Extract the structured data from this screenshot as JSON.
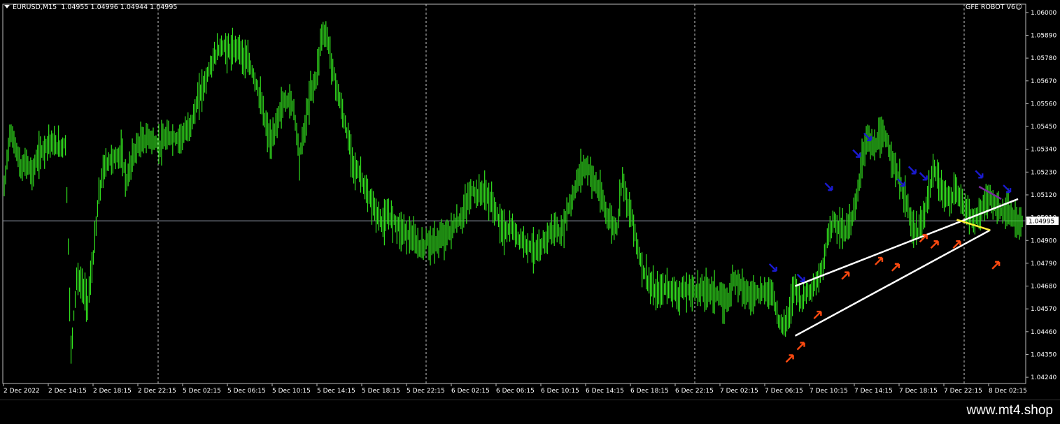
{
  "header": {
    "symbol": "EURUSD,M15",
    "ohlc": "1.04955 1.04996 1.04944 1.04995"
  },
  "indicator_label": "GFE ROBOT V6",
  "footer": {
    "brand": "www.mt4.shop"
  },
  "colors": {
    "background": "#000000",
    "candle": "#32e21e",
    "grid": "#c8c8c8",
    "text": "#ffffff",
    "current_price_line": "#8a8fa0",
    "trendline": "#ffffff",
    "down_arrow": "#1a1ad0",
    "up_arrow": "#ff4a10",
    "yellow_line": "#ffee33",
    "purple_line": "#7a2aa0"
  },
  "chart_data": {
    "type": "candlestick",
    "title": "EURUSD,M15",
    "xlabel": "",
    "ylabel": "",
    "grid": "vertical dashed",
    "current_price": 1.04995,
    "ylim": [
      1.0421,
      1.0604
    ],
    "y_ticks": [
      "1.06000",
      "1.05890",
      "1.05780",
      "1.05670",
      "1.05560",
      "1.05450",
      "1.05340",
      "1.05230",
      "1.05120",
      "1.05010",
      "1.04900",
      "1.04790",
      "1.04680",
      "1.04570",
      "1.04460",
      "1.04350",
      "1.04240"
    ],
    "x_ticks": [
      "2 Dec 2022",
      "2 Dec 14:15",
      "2 Dec 18:15",
      "2 Dec 22:15",
      "5 Dec 02:15",
      "5 Dec 06:15",
      "5 Dec 10:15",
      "5 Dec 14:15",
      "5 Dec 18:15",
      "5 Dec 22:15",
      "6 Dec 02:15",
      "6 Dec 06:15",
      "6 Dec 10:15",
      "6 Dec 14:15",
      "6 Dec 18:15",
      "6 Dec 22:15",
      "7 Dec 02:15",
      "7 Dec 06:15",
      "7 Dec 10:15",
      "7 Dec 14:15",
      "7 Dec 18:15",
      "7 Dec 22:15",
      "8 Dec 02:15"
    ],
    "close_path": [
      [
        0,
        1.0515
      ],
      [
        1,
        1.0542
      ],
      [
        2,
        1.0536
      ],
      [
        3,
        1.0524
      ],
      [
        4,
        1.0528
      ],
      [
        5,
        1.0522
      ],
      [
        6,
        1.053
      ],
      [
        7,
        1.0534
      ],
      [
        8,
        1.0538
      ],
      [
        9,
        1.0536
      ],
      [
        10,
        1.0535
      ],
      [
        11,
        1.0537
      ],
      [
        12,
        1.0436
      ],
      [
        13,
        1.0472
      ],
      [
        14,
        1.0468
      ],
      [
        15,
        1.046
      ],
      [
        16,
        1.0482
      ],
      [
        17,
        1.0512
      ],
      [
        18,
        1.0526
      ],
      [
        19,
        1.0529
      ],
      [
        20,
        1.053
      ],
      [
        21,
        1.0532
      ],
      [
        22,
        1.0518
      ],
      [
        23,
        1.053
      ],
      [
        24,
        1.0536
      ],
      [
        25,
        1.0538
      ],
      [
        26,
        1.054
      ],
      [
        27,
        1.0537
      ],
      [
        28,
        1.0536
      ],
      [
        29,
        1.0539
      ],
      [
        30,
        1.054
      ],
      [
        31,
        1.0539
      ],
      [
        32,
        1.0541
      ],
      [
        33,
        1.0543
      ],
      [
        34,
        1.055
      ],
      [
        35,
        1.056
      ],
      [
        36,
        1.0566
      ],
      [
        37,
        1.0574
      ],
      [
        38,
        1.058
      ],
      [
        39,
        1.0584
      ],
      [
        40,
        1.0582
      ],
      [
        41,
        1.0581
      ],
      [
        42,
        1.0584
      ],
      [
        43,
        1.0578
      ],
      [
        44,
        1.0575
      ],
      [
        45,
        1.0568
      ],
      [
        46,
        1.0558
      ],
      [
        47,
        1.0545
      ],
      [
        48,
        1.0536
      ],
      [
        49,
        1.0548
      ],
      [
        50,
        1.0556
      ],
      [
        51,
        1.0558
      ],
      [
        52,
        1.0554
      ],
      [
        53,
        1.053
      ],
      [
        54,
        1.0545
      ],
      [
        55,
        1.0562
      ],
      [
        56,
        1.0568
      ],
      [
        57,
        1.059
      ],
      [
        58,
        1.0588
      ],
      [
        59,
        1.0572
      ],
      [
        60,
        1.056
      ],
      [
        61,
        1.0548
      ],
      [
        62,
        1.0536
      ],
      [
        63,
        1.0524
      ],
      [
        64,
        1.0522
      ],
      [
        65,
        1.0512
      ],
      [
        66,
        1.0508
      ],
      [
        67,
        1.0502
      ],
      [
        68,
        1.0498
      ],
      [
        69,
        1.0502
      ],
      [
        70,
        1.05
      ],
      [
        71,
        1.0496
      ],
      [
        72,
        1.0494
      ],
      [
        73,
        1.0492
      ],
      [
        74,
        1.0488
      ],
      [
        75,
        1.0486
      ],
      [
        76,
        1.049
      ],
      [
        77,
        1.0488
      ],
      [
        78,
        1.049
      ],
      [
        79,
        1.0492
      ],
      [
        80,
        1.0494
      ],
      [
        81,
        1.0498
      ],
      [
        82,
        1.05
      ],
      [
        83,
        1.0508
      ],
      [
        84,
        1.0514
      ],
      [
        85,
        1.0512
      ],
      [
        86,
        1.0514
      ],
      [
        87,
        1.051
      ],
      [
        88,
        1.0506
      ],
      [
        89,
        1.0498
      ],
      [
        90,
        1.0494
      ],
      [
        91,
        1.0496
      ],
      [
        92,
        1.0492
      ],
      [
        93,
        1.049
      ],
      [
        94,
        1.0488
      ],
      [
        95,
        1.0486
      ],
      [
        96,
        1.0484
      ],
      [
        97,
        1.049
      ],
      [
        98,
        1.0494
      ],
      [
        99,
        1.0496
      ],
      [
        100,
        1.0492
      ],
      [
        101,
        1.0504
      ],
      [
        102,
        1.051
      ],
      [
        103,
        1.052
      ],
      [
        104,
        1.0526
      ],
      [
        105,
        1.0524
      ],
      [
        106,
        1.0518
      ],
      [
        107,
        1.0512
      ],
      [
        108,
        1.0504
      ],
      [
        109,
        1.0498
      ],
      [
        110,
        1.0496
      ],
      [
        111,
        1.0522
      ],
      [
        112,
        1.0506
      ],
      [
        113,
        1.0498
      ],
      [
        114,
        1.0482
      ],
      [
        115,
        1.0474
      ],
      [
        116,
        1.0468
      ],
      [
        117,
        1.0464
      ],
      [
        118,
        1.0466
      ],
      [
        119,
        1.0468
      ],
      [
        120,
        1.0466
      ],
      [
        121,
        1.0464
      ],
      [
        122,
        1.0466
      ],
      [
        123,
        1.0466
      ],
      [
        124,
        1.0466
      ],
      [
        125,
        1.0466
      ],
      [
        126,
        1.0466
      ],
      [
        127,
        1.0466
      ],
      [
        128,
        1.0464
      ],
      [
        129,
        1.046
      ],
      [
        130,
        1.0462
      ],
      [
        131,
        1.0472
      ],
      [
        132,
        1.047
      ],
      [
        133,
        1.0466
      ],
      [
        134,
        1.0462
      ],
      [
        135,
        1.0466
      ],
      [
        136,
        1.0464
      ],
      [
        137,
        1.0466
      ],
      [
        138,
        1.0464
      ],
      [
        139,
        1.0452
      ],
      [
        140,
        1.0448
      ],
      [
        141,
        1.0456
      ],
      [
        142,
        1.047
      ],
      [
        143,
        1.046
      ],
      [
        144,
        1.0466
      ],
      [
        145,
        1.0466
      ],
      [
        146,
        1.047
      ],
      [
        147,
        1.0478
      ],
      [
        148,
        1.0494
      ],
      [
        149,
        1.05
      ],
      [
        150,
        1.0496
      ],
      [
        151,
        1.0494
      ],
      [
        152,
        1.05
      ],
      [
        153,
        1.0508
      ],
      [
        154,
        1.053
      ],
      [
        155,
        1.054
      ],
      [
        156,
        1.0534
      ],
      [
        157,
        1.0538
      ],
      [
        158,
        1.0541
      ],
      [
        159,
        1.0534
      ],
      [
        160,
        1.0524
      ],
      [
        161,
        1.0516
      ],
      [
        162,
        1.0508
      ],
      [
        163,
        1.0496
      ],
      [
        164,
        1.0494
      ],
      [
        165,
        1.05
      ],
      [
        166,
        1.0514
      ],
      [
        167,
        1.0524
      ],
      [
        168,
        1.0516
      ],
      [
        169,
        1.0512
      ],
      [
        170,
        1.051
      ],
      [
        171,
        1.0514
      ],
      [
        172,
        1.0508
      ],
      [
        173,
        1.0504
      ],
      [
        174,
        1.05
      ],
      [
        175,
        1.0502
      ],
      [
        176,
        1.0508
      ],
      [
        177,
        1.051
      ],
      [
        178,
        1.0506
      ],
      [
        179,
        1.0504
      ],
      [
        180,
        1.0504
      ],
      [
        181,
        1.05
      ],
      [
        182,
        1.0499
      ]
    ],
    "trendlines": [
      {
        "color": "white",
        "from": [
          142,
          1.0468
        ],
        "to": [
          182,
          1.051
        ]
      },
      {
        "color": "white",
        "from": [
          142,
          1.0444
        ],
        "to": [
          177,
          1.0495
        ]
      },
      {
        "color": "yellow",
        "from": [
          171,
          1.05
        ],
        "to": [
          177,
          1.0495
        ]
      },
      {
        "color": "purple",
        "from": [
          175,
          1.0516
        ],
        "to": [
          179,
          1.051
        ]
      }
    ],
    "down_arrows": [
      [
        138,
        1.0477
      ],
      [
        143,
        1.0472
      ],
      [
        148,
        1.0516
      ],
      [
        153,
        1.0532
      ],
      [
        155,
        1.054
      ],
      [
        161,
        1.0518
      ],
      [
        163,
        1.0524
      ],
      [
        165,
        1.0521
      ],
      [
        175,
        1.0522
      ],
      [
        180,
        1.0515
      ]
    ],
    "up_arrows": [
      [
        141,
        1.0433
      ],
      [
        143,
        1.0439
      ],
      [
        146,
        1.0454
      ],
      [
        151,
        1.0473
      ],
      [
        157,
        1.048
      ],
      [
        160,
        1.0477
      ],
      [
        165,
        1.0491
      ],
      [
        167,
        1.0488
      ],
      [
        171,
        1.0488
      ],
      [
        178,
        1.0478
      ]
    ]
  }
}
